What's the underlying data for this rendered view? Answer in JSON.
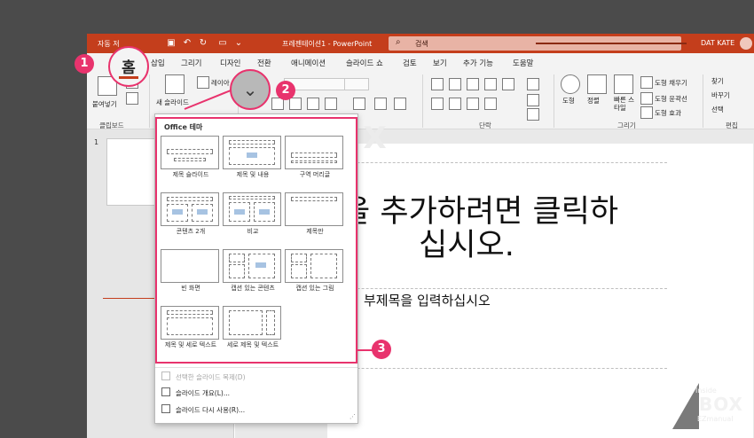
{
  "titlebar": {
    "autosave": "자동 저",
    "document_title": "프레젠테이션1 - PowerPoint",
    "search_placeholder": "검색",
    "user": "DAT KATE"
  },
  "tabs": [
    "삽입",
    "그리기",
    "디자인",
    "전환",
    "애니메이션",
    "슬라이드 쇼",
    "검토",
    "보기",
    "추가 기능",
    "도움말"
  ],
  "home_tab": "홈",
  "ribbon": {
    "paste": "붙여넣기",
    "clipboard": "클립보드",
    "new_slide": "새 슬라이드",
    "layout_partial": "레이아",
    "paragraph": "단락",
    "shape": "도형",
    "arrange": "정렬",
    "quick_styles": "빠른 스타일",
    "shape_fill": "도형 채우기",
    "shape_outline": "도형 윤곽선",
    "shape_effects": "도형 효과",
    "drawing": "그리기",
    "find": "찾기",
    "replace": "바꾸기",
    "select": "선택",
    "editing": "편집"
  },
  "slide": {
    "number": "1",
    "title_line1": "목을 추가하려면 클릭하",
    "title_line2": "십시오.",
    "subtitle": "부제목을 입력하십시오"
  },
  "dropdown": {
    "section": "Office 테마",
    "layouts": [
      {
        "label": "제목 슬라이드"
      },
      {
        "label": "제목 및 내용"
      },
      {
        "label": "구역 머리글"
      },
      {
        "label": "콘텐츠 2개"
      },
      {
        "label": "비교"
      },
      {
        "label": "제목만"
      },
      {
        "label": "빈 화면"
      },
      {
        "label": "캡션 있는 콘텐츠"
      },
      {
        "label": "캡션 있는 그림"
      },
      {
        "label": "제목 및 세로 텍스트"
      },
      {
        "label": "세로 제목 및 텍스트"
      }
    ],
    "menu": [
      {
        "label": "선택한 슬라이드 복제(D)",
        "disabled": true
      },
      {
        "label": "슬라이드 개요(L)...",
        "disabled": false
      },
      {
        "label": "슬라이드 다시 사용(R)...",
        "disabled": false
      }
    ]
  },
  "annotations": {
    "one": "1",
    "two": "2",
    "three": "3"
  },
  "logo": {
    "top": "Inside",
    "main": "BOX",
    "bottom": "EZmanual"
  },
  "watermark": "e BOX"
}
